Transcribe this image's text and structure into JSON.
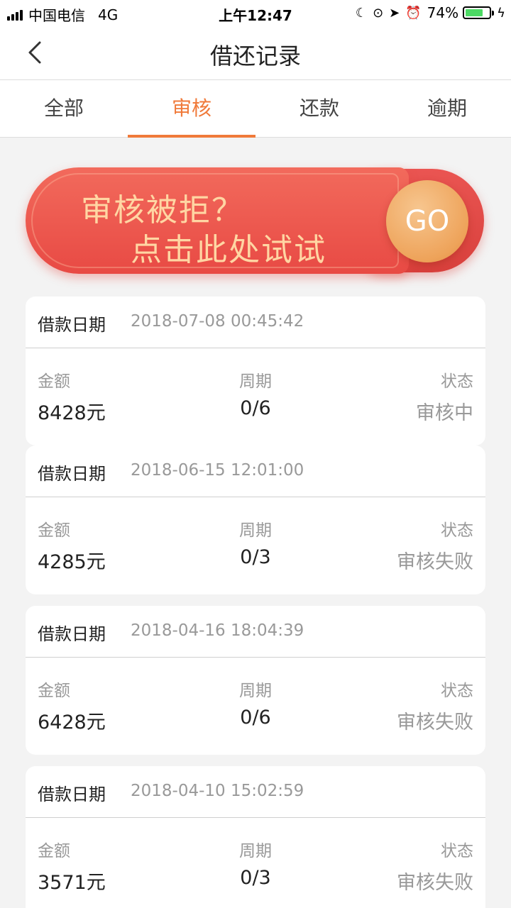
{
  "status_bar": {
    "carrier": "中国电信",
    "network": "4G",
    "time": "上午12:47",
    "battery_percent": "74%",
    "battery_level": 0.74,
    "icons": [
      "moon-icon",
      "rotation-lock-icon",
      "location-icon",
      "alarm-icon",
      "charging-icon"
    ]
  },
  "nav": {
    "title": "借还记录",
    "back_icon": "chevron-left-icon"
  },
  "tabs": [
    {
      "label": "全部",
      "active": false
    },
    {
      "label": "审核",
      "active": true
    },
    {
      "label": "还款",
      "active": false
    },
    {
      "label": "逾期",
      "active": false
    }
  ],
  "banner": {
    "line1": "审核被拒？",
    "line2": "点击此处试试",
    "go_label": "GO"
  },
  "colors": {
    "accent": "#f07a3a",
    "banner_red": "#e84a44",
    "banner_text": "#ffd6a3",
    "muted": "#999999"
  },
  "records": [
    {
      "date_label": "借款日期",
      "date": "2018-07-08 00:45:42",
      "amount_label": "金额",
      "amount": "8428元",
      "period_label": "周期",
      "period": "0/6",
      "status_label": "状态",
      "status": "审核中"
    },
    {
      "date_label": "借款日期",
      "date": "2018-06-15 12:01:00",
      "amount_label": "金额",
      "amount": "4285元",
      "period_label": "周期",
      "period": "0/3",
      "status_label": "状态",
      "status": "审核失败"
    },
    {
      "date_label": "借款日期",
      "date": "2018-04-16 18:04:39",
      "amount_label": "金额",
      "amount": "6428元",
      "period_label": "周期",
      "period": "0/6",
      "status_label": "状态",
      "status": "审核失败"
    },
    {
      "date_label": "借款日期",
      "date": "2018-04-10 15:02:59",
      "amount_label": "金额",
      "amount": "3571元",
      "period_label": "周期",
      "period": "0/3",
      "status_label": "状态",
      "status": "审核失败"
    }
  ]
}
